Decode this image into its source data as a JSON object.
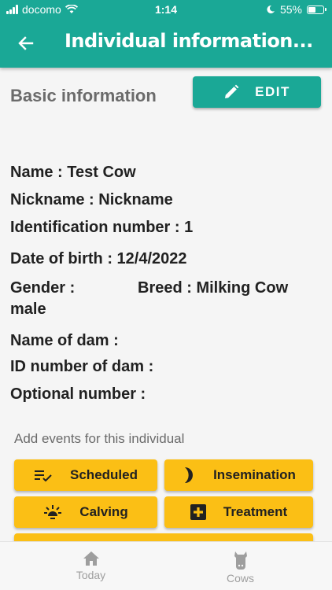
{
  "status_bar": {
    "carrier": "docomo",
    "time": "1:14",
    "battery": "55%",
    "battery_level": 0.55
  },
  "header": {
    "title": "Individual information..."
  },
  "basic_info": {
    "title": "Basic information",
    "edit_label": "EDIT"
  },
  "fields": {
    "name": "Name : Test Cow",
    "nickname": "Nickname :  Nickname",
    "id_number": "Identification number : 1",
    "dob": "Date of birth : 12/4/2022",
    "gender_label": "Gender :",
    "gender_value": "male",
    "breed": "Breed : Milking Cow",
    "dam_name": "Name of dam :",
    "dam_id": "ID number of dam :",
    "optional_number": "Optional number :"
  },
  "events": {
    "label": "Add events for this individual",
    "buttons": [
      "Scheduled",
      "Insemination",
      "Calving",
      "Treatment"
    ]
  },
  "bottom_nav": {
    "today": "Today",
    "cows": "Cows"
  },
  "colors": {
    "primary": "#1aa896",
    "accent": "#fbbf15",
    "muted": "#9e9e9e"
  }
}
